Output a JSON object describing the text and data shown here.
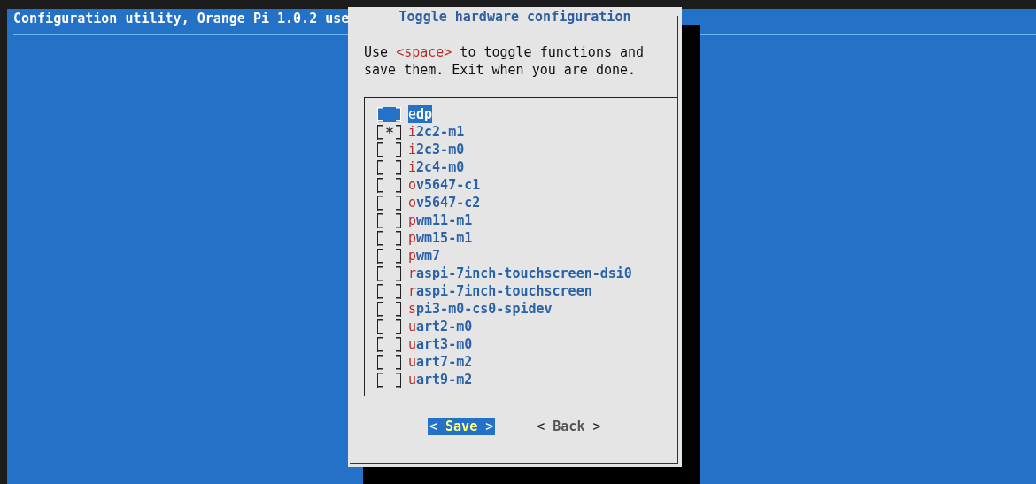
{
  "header": {
    "title": "Configuration utility, Orange Pi 1.0.2 use"
  },
  "dialog": {
    "title": "Toggle hardware configuration",
    "prompt": [
      {
        "text": "Use ",
        "kind": "plain"
      },
      {
        "text": "<space>",
        "kind": "key"
      },
      {
        "text": " to toggle functions and save them. Exit when you are done.",
        "kind": "plain"
      }
    ],
    "items": [
      {
        "label": "edp",
        "checked": false,
        "selected": true
      },
      {
        "label": "i2c2-m1",
        "checked": true,
        "selected": false
      },
      {
        "label": "i2c3-m0",
        "checked": false,
        "selected": false
      },
      {
        "label": "i2c4-m0",
        "checked": false,
        "selected": false
      },
      {
        "label": "ov5647-c1",
        "checked": false,
        "selected": false
      },
      {
        "label": "ov5647-c2",
        "checked": false,
        "selected": false
      },
      {
        "label": "pwm11-m1",
        "checked": false,
        "selected": false
      },
      {
        "label": "pwm15-m1",
        "checked": false,
        "selected": false
      },
      {
        "label": "pwm7",
        "checked": false,
        "selected": false
      },
      {
        "label": "raspi-7inch-touchscreen-dsi0",
        "checked": false,
        "selected": false
      },
      {
        "label": "raspi-7inch-touchscreen",
        "checked": false,
        "selected": false
      },
      {
        "label": "spi3-m0-cs0-spidev",
        "checked": false,
        "selected": false
      },
      {
        "label": "uart2-m0",
        "checked": false,
        "selected": false
      },
      {
        "label": "uart3-m0",
        "checked": false,
        "selected": false
      },
      {
        "label": "uart7-m2",
        "checked": false,
        "selected": false
      },
      {
        "label": "uart9-m2",
        "checked": false,
        "selected": false
      }
    ],
    "buttons": [
      {
        "open": "<",
        "label": "Save",
        "close": ">",
        "selected": true
      },
      {
        "open": "<",
        "label": "Back",
        "close": ">",
        "selected": false
      }
    ]
  }
}
